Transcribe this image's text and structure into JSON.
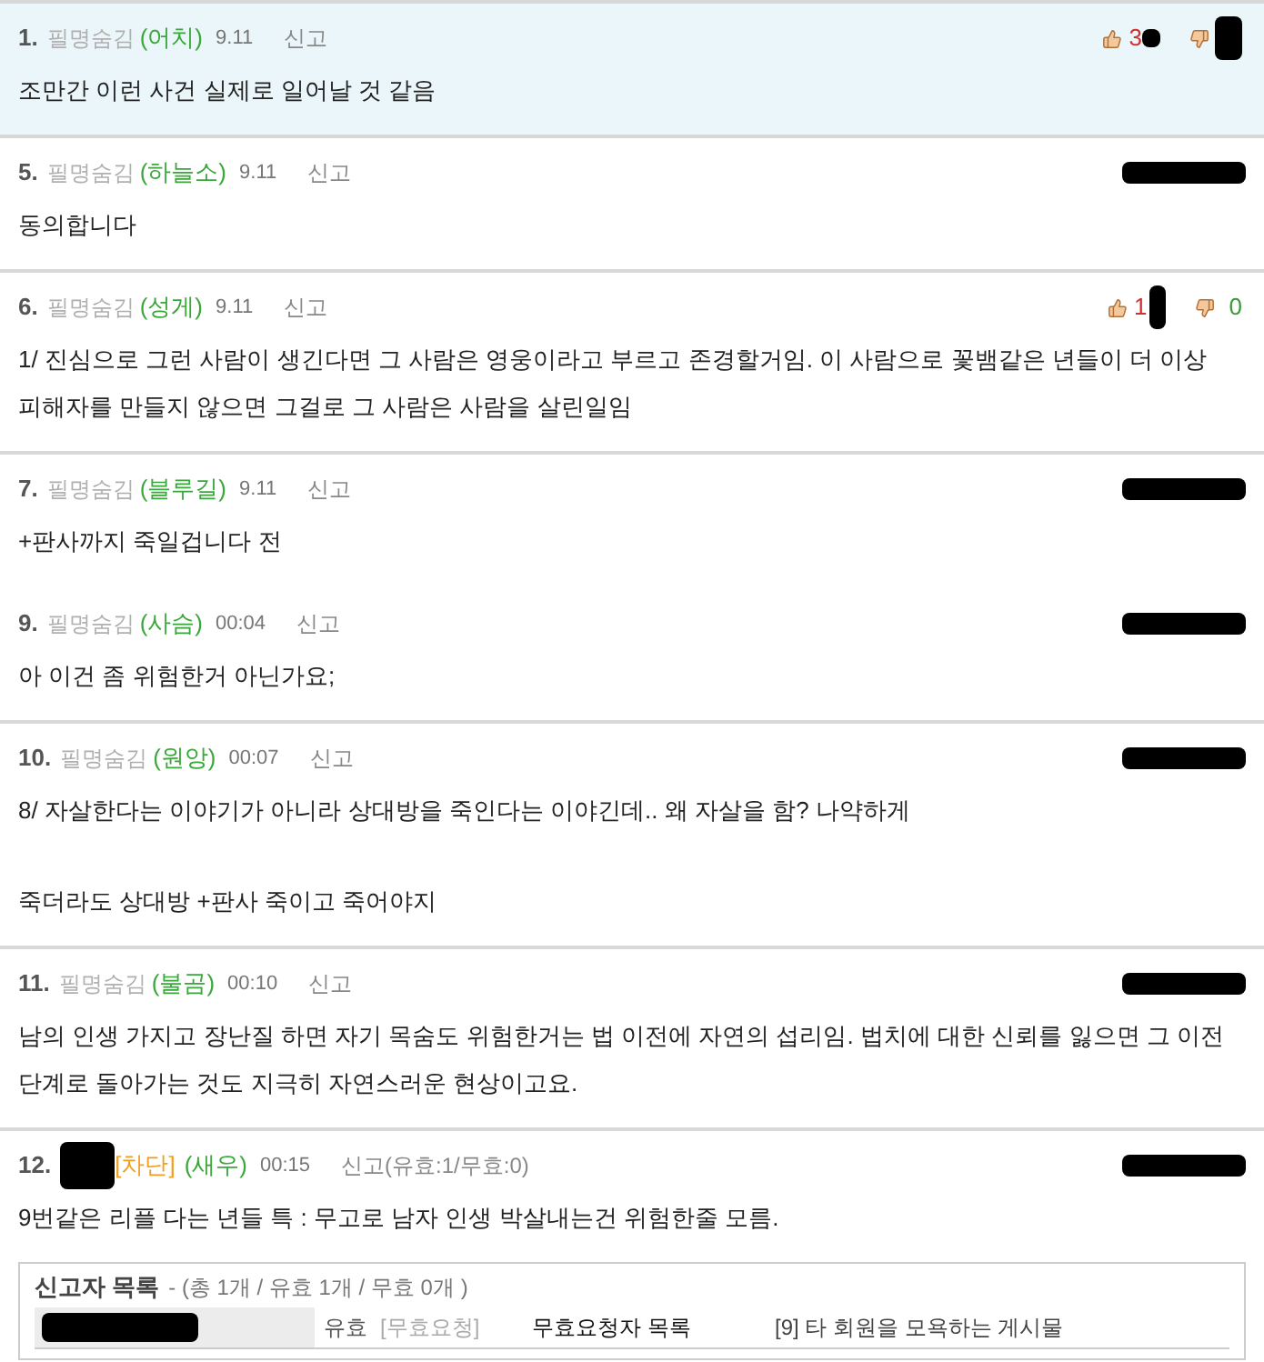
{
  "comments": [
    {
      "number": "1.",
      "author": {
        "kind": "hidden",
        "label": "필명숨김"
      },
      "nick": "(어치)",
      "time": "9.11",
      "report": "신고",
      "highlighted": true,
      "divider": true,
      "votes": {
        "kind": "counts",
        "up": "3",
        "up_redacted": true,
        "down_redacted": true
      },
      "paragraphs": [
        "조만간 이런 사건 실제로 일어날 것 같음"
      ]
    },
    {
      "number": "5.",
      "author": {
        "kind": "hidden",
        "label": "필명숨김"
      },
      "nick": "(하늘소)",
      "time": "9.11",
      "report": "신고",
      "highlighted": false,
      "divider": true,
      "votes": {
        "kind": "redacted"
      },
      "paragraphs": [
        "동의합니다"
      ]
    },
    {
      "number": "6.",
      "author": {
        "kind": "hidden",
        "label": "필명숨김"
      },
      "nick": "(성게)",
      "time": "9.11",
      "report": "신고",
      "highlighted": false,
      "divider": true,
      "votes": {
        "kind": "counts",
        "up": "1",
        "up_redacted": true,
        "down": "0"
      },
      "paragraphs": [
        "1/ 진심으로 그런 사람이 생긴다면 그 사람은 영웅이라고 부르고 존경할거임. 이 사람으로 꽃뱀같은 년들이 더 이상 피해자를 만들지 않으면 그걸로 그 사람은 사람을 살린일임"
      ]
    },
    {
      "number": "7.",
      "author": {
        "kind": "hidden",
        "label": "필명숨김"
      },
      "nick": "(블루길)",
      "time": "9.11",
      "report": "신고",
      "highlighted": false,
      "divider": true,
      "votes": {
        "kind": "redacted"
      },
      "paragraphs": [
        "+판사까지 죽일겁니다 전"
      ]
    },
    {
      "number": "9.",
      "author": {
        "kind": "hidden",
        "label": "필명숨김"
      },
      "nick": "(사슴)",
      "time": "00:04",
      "report": "신고",
      "highlighted": false,
      "divider": false,
      "votes": {
        "kind": "redacted"
      },
      "paragraphs": [
        "아 이건 좀 위험한거 아닌가요;"
      ]
    },
    {
      "number": "10.",
      "author": {
        "kind": "hidden",
        "label": "필명숨김"
      },
      "nick": "(원앙)",
      "time": "00:07",
      "report": "신고",
      "highlighted": false,
      "divider": true,
      "votes": {
        "kind": "redacted"
      },
      "paragraphs": [
        "8/ 자살한다는 이야기가 아니라 상대방을 죽인다는 이야긴데.. 왜 자살을 함? 나약하게",
        "죽더라도 상대방 +판사 죽이고 죽어야지"
      ]
    },
    {
      "number": "11.",
      "author": {
        "kind": "hidden",
        "label": "필명숨김"
      },
      "nick": "(불곰)",
      "time": "00:10",
      "report": "신고",
      "highlighted": false,
      "divider": true,
      "votes": {
        "kind": "redacted"
      },
      "paragraphs": [
        "남의 인생 가지고 장난질 하면 자기 목숨도 위험한거는 법 이전에 자연의 섭리임. 법치에 대한 신뢰를 잃으면 그 이전 단계로 돌아가는 것도 지극히 자연스러운 현상이고요."
      ]
    },
    {
      "number": "12.",
      "author": {
        "kind": "redacted",
        "tag": "[차단]"
      },
      "nick": "(새우)",
      "time": "00:15",
      "report": "신고(유효:1/무효:0)",
      "highlighted": false,
      "divider": true,
      "votes": {
        "kind": "redacted"
      },
      "paragraphs": [
        "9번같은 리플 다는 년들 특 : 무고로 남자 인생 박살내는건 위험한줄 모름."
      ]
    }
  ],
  "report_list": {
    "title": "신고자 목록",
    "summary": "- (총 1개 / 유효 1개 / 무효 0개 )",
    "rows": [
      {
        "status": "유효",
        "action": "[무효요청]",
        "link": "무효요청자 목록",
        "reason": "[9] 타 회원을 모욕하는 게시물"
      }
    ]
  }
}
